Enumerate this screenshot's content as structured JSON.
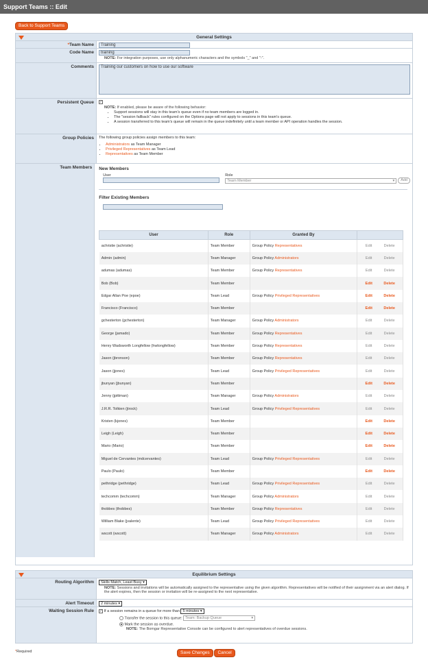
{
  "header": {
    "title": "Support Teams :: Edit"
  },
  "back_button": "Back to Support Teams",
  "general": {
    "title": "General Settings",
    "team_name": {
      "label": "Team Name",
      "value": "Training"
    },
    "code_name": {
      "label": "Code Name",
      "value": "training",
      "note_label": "NOTE:",
      "note": "For integration purposes, use only alphanumeric characters and the symbols \"_\" and \"-\"."
    },
    "comments": {
      "label": "Comments",
      "value": "Training our customers on how to use our software"
    },
    "persistent_queue": {
      "label": "Persistent Queue",
      "checked": true,
      "check_glyph": "✓",
      "note_label": "NOTE:",
      "note": "If enabled, please be aware of the following behavior:",
      "bullets": [
        "Support sessions will stay in this team's queue even if no team members are logged in.",
        "The \"session fallback\" rules configured on the Options page will not apply to sessions in this team's queue.",
        "A session transferred to this team's queue will remain in the queue indefinitely until a team member or API operation handles the session."
      ]
    },
    "group_policies": {
      "label": "Group Policies",
      "intro": "The following group policies assign members to this team:",
      "items": [
        {
          "policy": "Administrators",
          "role": "as Team Manager"
        },
        {
          "policy": "Privileged Representatives",
          "role": "as Team Lead"
        },
        {
          "policy": "Representatives",
          "role": "as Team Member"
        }
      ]
    },
    "team_members": {
      "label": "Team Members",
      "new_title": "New Members",
      "user_label": "User",
      "role_label": "Role",
      "role_value": "Team Member",
      "add_label": "Add",
      "filter_title": "Filter Existing Members",
      "columns": [
        "User",
        "Role",
        "Granted By",
        ""
      ],
      "edit_label": "Edit",
      "delete_label": "Delete",
      "group_policy_prefix": "Group Policy",
      "rows": [
        {
          "user": "achristie (achristie)",
          "role": "Team Member",
          "policy": "Representatives",
          "active": false
        },
        {
          "user": "Admin (admin)",
          "role": "Team Manager",
          "policy": "Administrators",
          "active": false
        },
        {
          "user": "adumas (adumas)",
          "role": "Team Member",
          "policy": "Representatives",
          "active": false
        },
        {
          "user": "Bob (Bob)",
          "role": "Team Member",
          "policy": "",
          "active": true
        },
        {
          "user": "Edgar Allan Poe (epoe)",
          "role": "Team Lead",
          "policy": "Privileged Representatives",
          "active": true
        },
        {
          "user": "Francisco (Francisco)",
          "role": "Team Member",
          "policy": "",
          "active": true
        },
        {
          "user": "gchesterton (gchesterton)",
          "role": "Team Manager",
          "policy": "Administrators",
          "active": false
        },
        {
          "user": "George (jamado)",
          "role": "Team Member",
          "policy": "Representatives",
          "active": false
        },
        {
          "user": "Henry Wadsworth Longfellow (hwlongfellow)",
          "role": "Team Member",
          "policy": "Representatives",
          "active": false
        },
        {
          "user": "Jason (jbronson)",
          "role": "Team Member",
          "policy": "Representatives",
          "active": false
        },
        {
          "user": "Jason (jjones)",
          "role": "Team Lead",
          "policy": "Privileged Representatives",
          "active": false
        },
        {
          "user": "jbunyan (jbunyan)",
          "role": "Team Member",
          "policy": "",
          "active": true
        },
        {
          "user": "Jenny (jpittman)",
          "role": "Team Manager",
          "policy": "Administrators",
          "active": false
        },
        {
          "user": "J.R.R. Tolkien (jtrock)",
          "role": "Team Lead",
          "policy": "Privileged Representatives",
          "active": false
        },
        {
          "user": "Kristen (kjones)",
          "role": "Team Member",
          "policy": "",
          "active": true
        },
        {
          "user": "Leigh (Leigh)",
          "role": "Team Member",
          "policy": "",
          "active": true
        },
        {
          "user": "Mario (Mario)",
          "role": "Team Member",
          "policy": "",
          "active": true
        },
        {
          "user": "Miguel de Cervantes (mdcervantes)",
          "role": "Team Lead",
          "policy": "Privileged Representatives",
          "active": false
        },
        {
          "user": "Paulo (Paulo)",
          "role": "Team Member",
          "policy": "",
          "active": true
        },
        {
          "user": "pethridge (pethridge)",
          "role": "Team Lead",
          "policy": "Privileged Representatives",
          "active": false
        },
        {
          "user": "techcomm (techcomm)",
          "role": "Team Manager",
          "policy": "Administrators",
          "active": false
        },
        {
          "user": "thobbes (thobbes)",
          "role": "Team Member",
          "policy": "Representatives",
          "active": false
        },
        {
          "user": "William Blake (jvalente)",
          "role": "Team Lead",
          "policy": "Privileged Representatives",
          "active": false
        },
        {
          "user": "wscott (wscott)",
          "role": "Team Manager",
          "policy": "Administrators",
          "active": false
        }
      ]
    }
  },
  "equilibrium": {
    "title": "Equilibrium Settings",
    "routing": {
      "label": "Routing Algorithm",
      "value": "Skills Match, Least Busy",
      "note_label": "NOTE:",
      "note": "Sessions and invitations will be automatically assigned to the representative using the given algorithm. Representatives will be notified of their assignment via an alert dialog. If the alert expires, then the session or invitation will be re-assigned to the next representative."
    },
    "alert_timeout": {
      "label": "Alert Timeout",
      "value": "2 minutes"
    },
    "waiting_rule": {
      "label": "Waiting Session Rule",
      "check_text": "If a session remains in a queue for more than",
      "time_value": "5 minutes",
      "option1": "Transfer the session to this queue:",
      "option1_value": "Team: Backup Queue",
      "option2": "Mark the session as overdue.",
      "note_label": "NOTE:",
      "note": "The Bomgar Representative Console can be configured to alert representatives of overdue sessions."
    }
  },
  "footer": {
    "required": "Required",
    "save": "Save Changes",
    "cancel": "Cancel"
  },
  "colors": {
    "accent": "#e8581c",
    "panel_header": "#dde6f0",
    "topbar": "#616161"
  },
  "icons": {
    "collapse": "collapse-triangle-icon",
    "dropdown": "chevron-down-icon"
  }
}
